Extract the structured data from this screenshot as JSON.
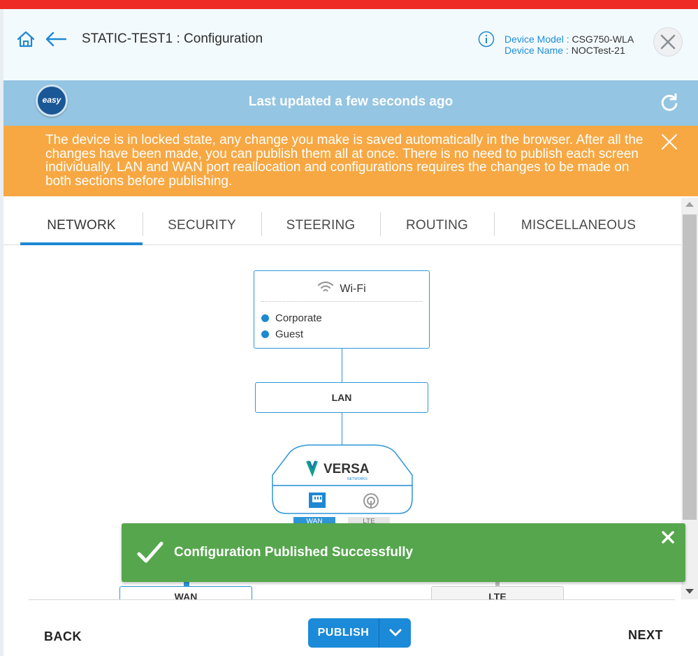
{
  "header": {
    "title": "STATIC-TEST1 : Configuration",
    "device_model_label": "Device Model :",
    "device_model_value": "CSG750-WLA",
    "device_name_label": "Device Name :",
    "device_name_value": "NOCTest-21"
  },
  "status": {
    "logo_text": "easy",
    "message": "Last updated a few seconds ago"
  },
  "warning": {
    "text": "The device is in locked state, any change you make is saved automatically in the browser. After all the changes have been made, you can publish them all at once. There is no need to publish each screen individually. LAN and WAN port reallocation and configurations requires the changes to be made on both sections before publishing."
  },
  "tabs": [
    {
      "label": "NETWORK",
      "active": true
    },
    {
      "label": "SECURITY",
      "active": false
    },
    {
      "label": "STEERING",
      "active": false
    },
    {
      "label": "ROUTING",
      "active": false
    },
    {
      "label": "MISCELLANEOUS",
      "active": false
    }
  ],
  "diagram": {
    "wifi_title": "Wi-Fi",
    "networks": [
      "Corporate",
      "Guest"
    ],
    "lan_label": "LAN",
    "device_brand": "VERSA",
    "device_sub": "NETWORKS",
    "wan_tag": "WAN",
    "lte_tag": "LTE",
    "wan_label": "WAN",
    "lte_label": "LTE"
  },
  "toast": {
    "message": "Configuration Published Successfully"
  },
  "footer": {
    "back_label": "BACK",
    "publish_label": "PUBLISH",
    "next_label": "NEXT"
  },
  "colors": {
    "accent": "#1e88d2",
    "header_bar": "#ee2b24",
    "status_bar": "#94c5e2",
    "warning_bar": "#f7a843",
    "toast": "#56a64d"
  }
}
